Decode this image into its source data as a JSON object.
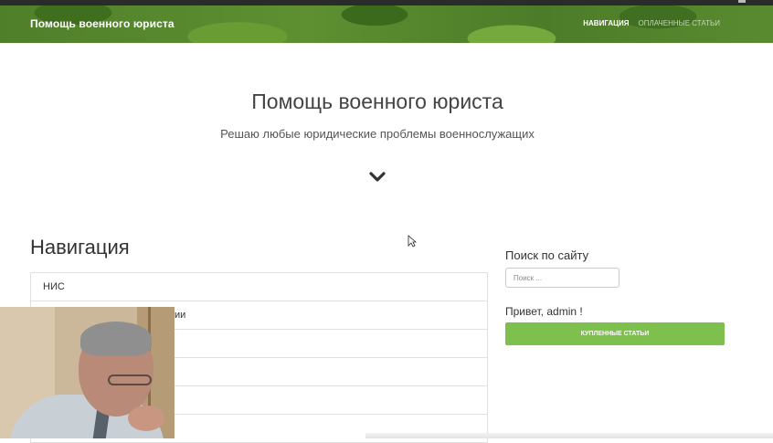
{
  "navbar": {
    "brand": "Помощь военного юриста",
    "links": [
      {
        "label": "НАВИГАЦИЯ",
        "active": true
      },
      {
        "label": "ОПЛАЧЕННЫЕ СТАТЬИ",
        "active": false
      }
    ]
  },
  "hero": {
    "title": "Помощь военного юриста",
    "subtitle": "Решаю любые юридические проблемы военнослужащих",
    "scroll_icon": "chevron-down-icon"
  },
  "navigation": {
    "title": "Навигация",
    "items": [
      {
        "label": "НИС"
      },
      {
        "label": "ии"
      },
      {
        "label": ""
      },
      {
        "label": ""
      },
      {
        "label": ""
      },
      {
        "label": ""
      }
    ]
  },
  "sidebar": {
    "search_label": "Поиск по сайту",
    "search_placeholder": "Поиск ...",
    "greeting": "Привет, admin !",
    "purchased_button": "КУПЛЕННЫЕ СТАТЬИ"
  },
  "colors": {
    "navbar_green": "#5e8f31",
    "button_green": "#7dc04d"
  }
}
